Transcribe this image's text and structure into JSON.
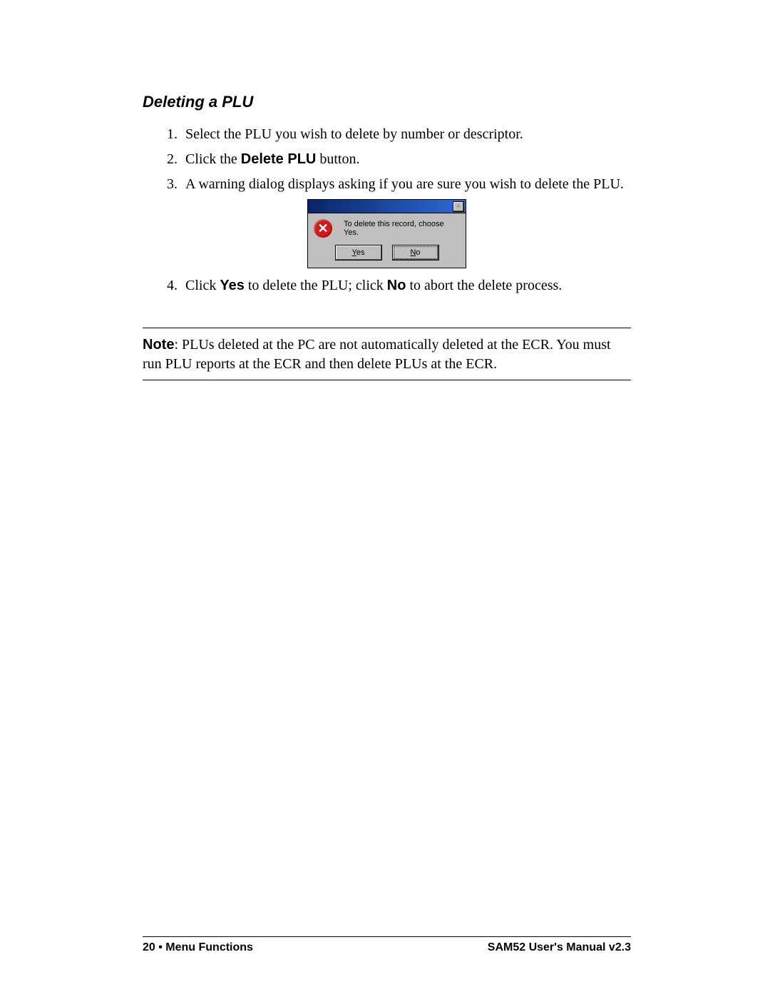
{
  "title": "Deleting a PLU",
  "steps": {
    "s1": "Select the PLU you wish to delete by number or descriptor.",
    "s2_a": "Click the ",
    "s2_bold": "Delete PLU",
    "s2_b": " button.",
    "s3": "A warning dialog displays asking if you are sure you wish to delete the PLU.",
    "s4_a": "Click ",
    "s4_yes": "Yes",
    "s4_b": " to delete the PLU; click ",
    "s4_no": "No",
    "s4_c": " to abort the delete process."
  },
  "dialog": {
    "message": "To delete this record, choose Yes.",
    "yes_letter": "Y",
    "yes_rest": "es",
    "no_letter": "N",
    "no_rest": "o",
    "close_glyph": "×",
    "error_glyph": "✕"
  },
  "note": {
    "label": "Note",
    "text": ":  PLUs deleted at the PC are not automatically deleted at the ECR.  You must run PLU reports at the ECR and then delete PLUs at the ECR."
  },
  "footer": {
    "left": "20  •  Menu Functions",
    "right": "SAM52 User's Manual v2.3"
  }
}
